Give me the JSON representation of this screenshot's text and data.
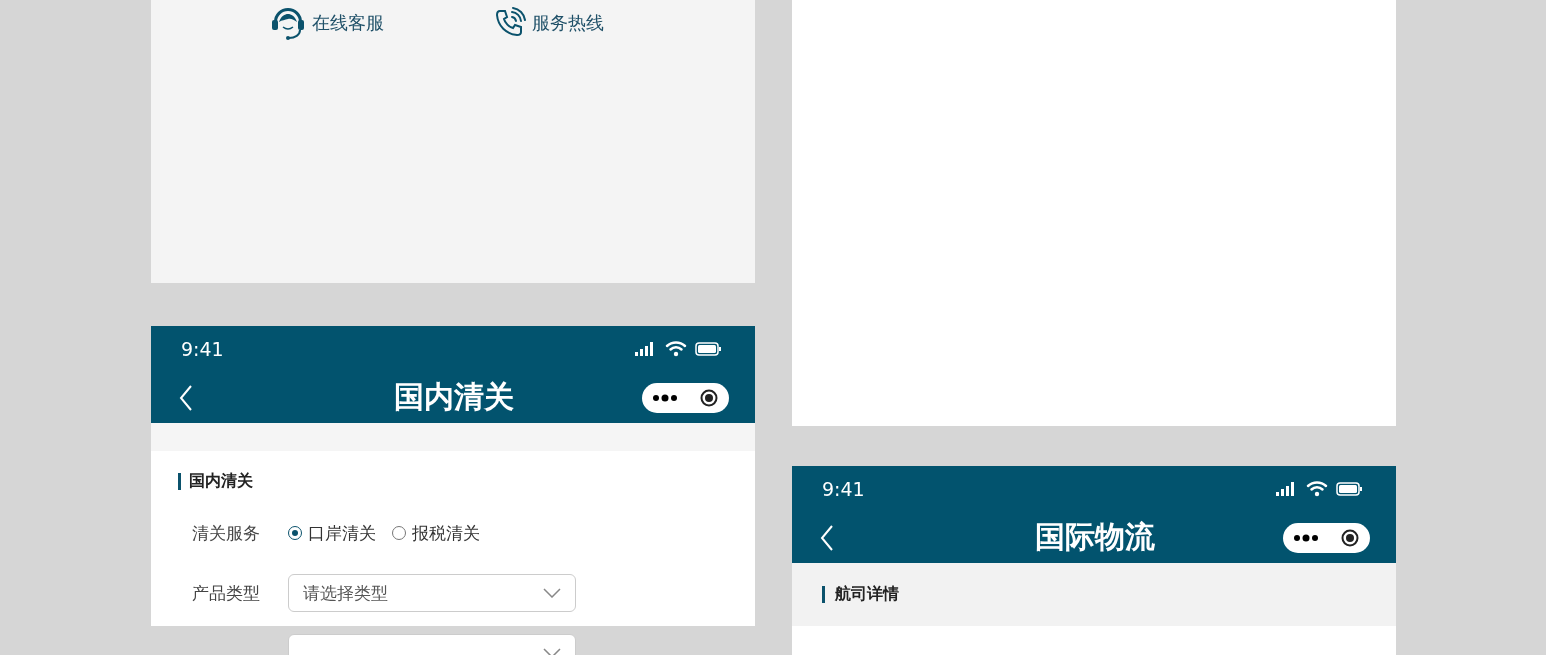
{
  "contact_bar": {
    "items": [
      {
        "kind": "headset",
        "label": "在线客服"
      },
      {
        "kind": "phone",
        "label": "服务热线"
      }
    ]
  },
  "customs_screen": {
    "status_bar": {
      "time": "9:41"
    },
    "nav_bar": {
      "title": "国内清关"
    },
    "section": {
      "title": "国内清关"
    },
    "form": [
      {
        "kind": "radio",
        "label": "清关服务",
        "options": [
          {
            "label": "口岸清关",
            "selected": true
          },
          {
            "label": "报税清关",
            "selected": false
          }
        ]
      },
      {
        "kind": "select",
        "label": "产品类型",
        "placeholder": "请选择类型"
      },
      {
        "kind": "select"
      }
    ]
  },
  "logistics_screen": {
    "status_bar": {
      "time": "9:41"
    },
    "nav_bar": {
      "title": "国际物流"
    },
    "section": {
      "title": "航司详情"
    }
  }
}
